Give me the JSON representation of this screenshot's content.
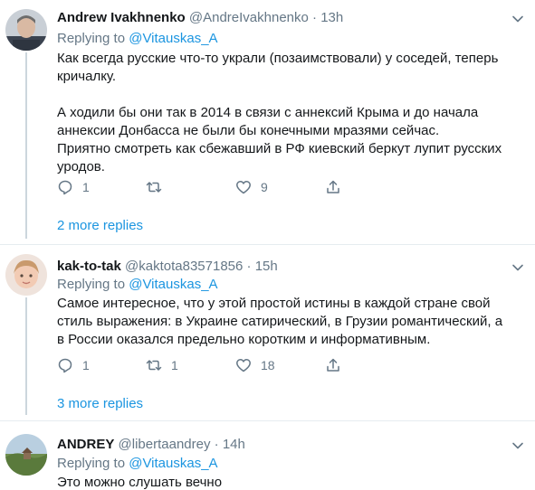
{
  "tweets": [
    {
      "name": "Andrew Ivakhnenko",
      "handle": "@AndreIvakhnenko",
      "dot": "·",
      "time": "13h",
      "replying_prefix": "Replying to",
      "replying_to": "@Vitauskas_A",
      "text_lines": [
        "Как всегда русские что-то украли (позаимствовали) у соседей, теперь",
        "кричалку.",
        "А ходили бы они так в 2014 в связи с аннексий Крыма и до начала",
        "аннексии Донбасса не были бы конечными мразями сейчас.",
        "Приятно смотреть как сбежавший в РФ киевский беркут лупит русских",
        "уродов."
      ],
      "replies": "1",
      "retweets": "",
      "likes": "9",
      "more_replies": "2 more replies"
    },
    {
      "name": "kak-to-tak",
      "handle": "@kaktota83571856",
      "dot": "·",
      "time": "15h",
      "replying_prefix": "Replying to",
      "replying_to": "@Vitauskas_A",
      "text_lines": [
        "Самое интересное, что у этой простой истины в каждой стране свой",
        "стиль выражения: в Украине сатирический, в Грузии романтический, а",
        "в России оказался предельно коротким и информативным."
      ],
      "replies": "1",
      "retweets": "1",
      "likes": "18",
      "more_replies": "3 more replies"
    },
    {
      "name": "ANDREY",
      "handle": "@libertaandrey",
      "dot": "·",
      "time": "14h",
      "replying_prefix": "Replying to",
      "replying_to": "@Vitauskas_A",
      "text_lines": [
        "Это можно слушать вечно"
      ]
    }
  ],
  "colors": {
    "link": "#1b95e0",
    "muted": "#657786",
    "divider": "#e6ecf0"
  },
  "icons": [
    "reply-icon",
    "retweet-icon",
    "like-icon",
    "share-icon",
    "chevron-down-icon"
  ]
}
